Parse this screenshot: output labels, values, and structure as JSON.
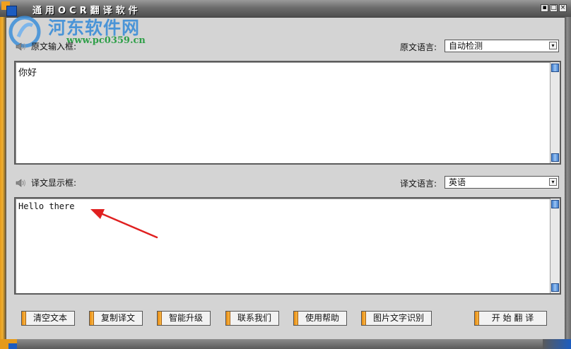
{
  "window": {
    "title": "通用OCR翻译软件",
    "buttons": [
      "▪",
      "□",
      "×"
    ]
  },
  "watermark": {
    "title": "河东软件网",
    "url": "www.pc0359.cn"
  },
  "source": {
    "label": "原文输入框:",
    "lang_label": "原文语言:",
    "lang_value": "自动检测",
    "text": "你好"
  },
  "target": {
    "label": "译文显示框:",
    "lang_label": "译文语言:",
    "lang_value": "英语",
    "text": "Hello there"
  },
  "buttons": {
    "clear": "清空文本",
    "copy": "复制译文",
    "upgrade": "智能升级",
    "contact": "联系我们",
    "help": "使用帮助",
    "ocr": "图片文字识别",
    "translate": "开 始 翻 译"
  },
  "colors": {
    "accent_orange": "#e88a10",
    "accent_blue": "#1c5cc0",
    "annotation_arrow": "#e02020"
  }
}
